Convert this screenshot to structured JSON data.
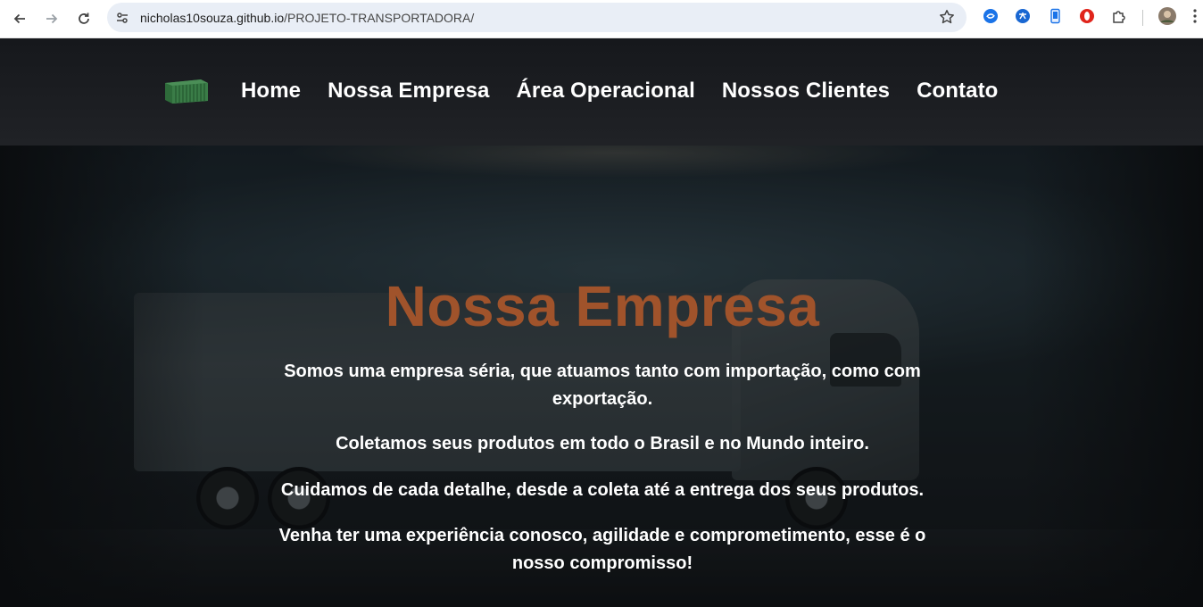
{
  "browser": {
    "url_host": "nicholas10souza.github.io",
    "url_path": "/PROJETO-TRANSPORTADORA/",
    "icons": [
      "back-icon",
      "forward-icon",
      "reload-icon",
      "site-info-icon",
      "bookmark-star-icon",
      "extension-sync-icon",
      "extension-translate-icon",
      "extension-phone-icon",
      "extension-opera-icon",
      "extensions-puzzle-icon",
      "profile-avatar",
      "menu-kebab-icon"
    ]
  },
  "site": {
    "logo": "container-logo",
    "nav": [
      {
        "label": "Home"
      },
      {
        "label": "Nossa Empresa"
      },
      {
        "label": "Área Operacional"
      },
      {
        "label": "Nossos Clientes"
      },
      {
        "label": "Contato"
      }
    ],
    "hero": {
      "title": "Nossa Empresa",
      "paragraphs": [
        "Somos uma empresa séria, que atuamos tanto com importação, como com exportação.",
        "Coletamos seus produtos em todo o Brasil e no Mundo inteiro.",
        "Cuidamos de cada detalhe, desde a coleta até a entrega dos seus produtos.",
        "Venha ter uma experiência conosco, agilidade e comprometimento, esse é o nosso compromisso!"
      ]
    },
    "colors": {
      "title": "#a0532b",
      "text": "#ffffff",
      "background": "#0e1013"
    }
  }
}
